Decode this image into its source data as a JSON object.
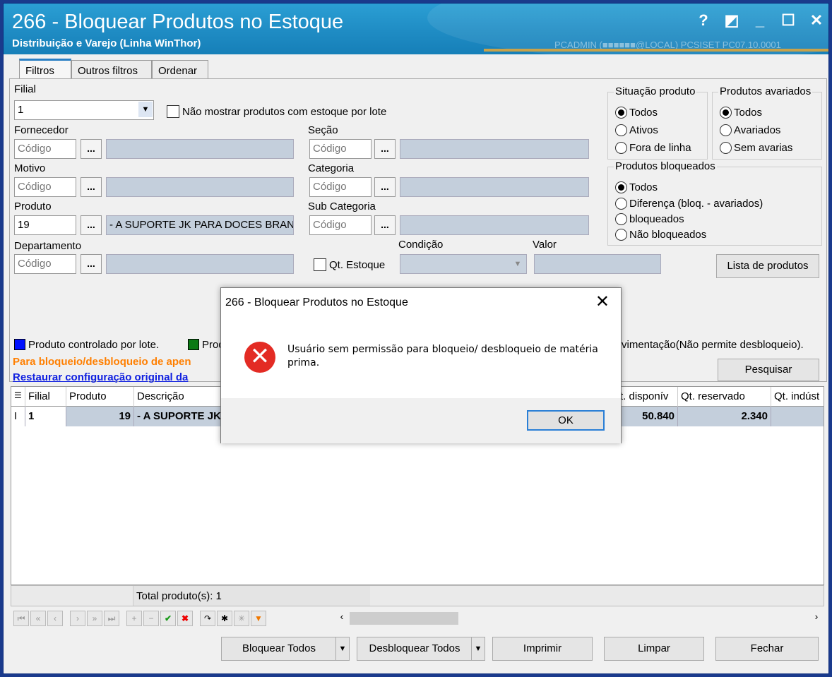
{
  "window": {
    "title": "266 - Bloquear Produtos no Estoque",
    "subtitle": "Distribuição e Varejo (Linha WinThor)",
    "user_info": "PCADMIN (■■■■■■@LOCAL)  PCSISET  PC07.10.0001",
    "buttons": {
      "help": "?",
      "restore": "◩",
      "minimize": "_",
      "maximize": "☐",
      "close": "✕"
    }
  },
  "tabs": [
    {
      "label": "Filtros"
    },
    {
      "label": "Outros filtros"
    },
    {
      "label": "Ordenar"
    }
  ],
  "filters": {
    "filial_label": "Filial",
    "filial_value": "1",
    "no_lote_label": "Não mostrar produtos com estoque por lote",
    "fornecedor_label": "Fornecedor",
    "fornecedor_placeholder": "Código",
    "motivo_label": "Motivo",
    "motivo_placeholder": "Código",
    "produto_label": "Produto",
    "produto_code": "19",
    "produto_desc": "- A SUPORTE JK PARA DOCES BRANCO",
    "departamento_label": "Departamento",
    "departamento_placeholder": "Código",
    "secao_label": "Seção",
    "secao_placeholder": "Código",
    "categoria_label": "Categoria",
    "categoria_placeholder": "Código",
    "subcategoria_label": "Sub Categoria",
    "subcategoria_placeholder": "Código",
    "qt_estoque_label": "Qt. Estoque",
    "condicao_label": "Condição",
    "valor_label": "Valor",
    "dots": "..."
  },
  "situacao": {
    "title": "Situação produto",
    "options": [
      "Todos",
      "Ativos",
      "Fora de linha"
    ]
  },
  "avariados": {
    "title": "Produtos avariados",
    "options": [
      "Todos",
      "Avariados",
      "Sem avarias"
    ]
  },
  "bloqueados": {
    "title": "Produtos bloqueados",
    "options": [
      "Todos",
      "Diferença (bloq. - avariados)",
      "bloqueados",
      "Não bloqueados"
    ]
  },
  "lista_produtos_button": "Lista de produtos",
  "pesquisar_button": "Pesquisar",
  "legend": {
    "lote": "Produto controlado por lote.",
    "second": "Prod",
    "third": "vimentação(Não permite desbloqueio).",
    "orange_note": "Para bloqueio/desbloqueio de apen",
    "restore_link": "Restaurar configuração original da",
    "colors": {
      "blue": "#0010ff",
      "green": "#0a7a14",
      "orange": "#ff7f00"
    }
  },
  "grid": {
    "headers": [
      "",
      "Filial",
      "Produto",
      "Descrição",
      "t. disponív",
      "Qt. reservado",
      "Qt. indúst"
    ],
    "row": {
      "marker": "I",
      "filial": "1",
      "produto": "19",
      "descricao": "- A SUPORTE JK",
      "disponivel": "50.840",
      "reservado": "2.340"
    },
    "total": "Total produto(s): 1"
  },
  "bottom_buttons": {
    "bloquear": "Bloquear Todos",
    "desbloquear": "Desbloquear Todos",
    "imprimir": "Imprimir",
    "limpar": "Limpar",
    "fechar": "Fechar"
  },
  "dialog": {
    "title": "266 - Bloquear Produtos no Estoque",
    "message": "Usuário sem permissão para bloqueio/ desbloqueio de matéria prima.",
    "ok": "OK",
    "icon": "error-icon"
  }
}
